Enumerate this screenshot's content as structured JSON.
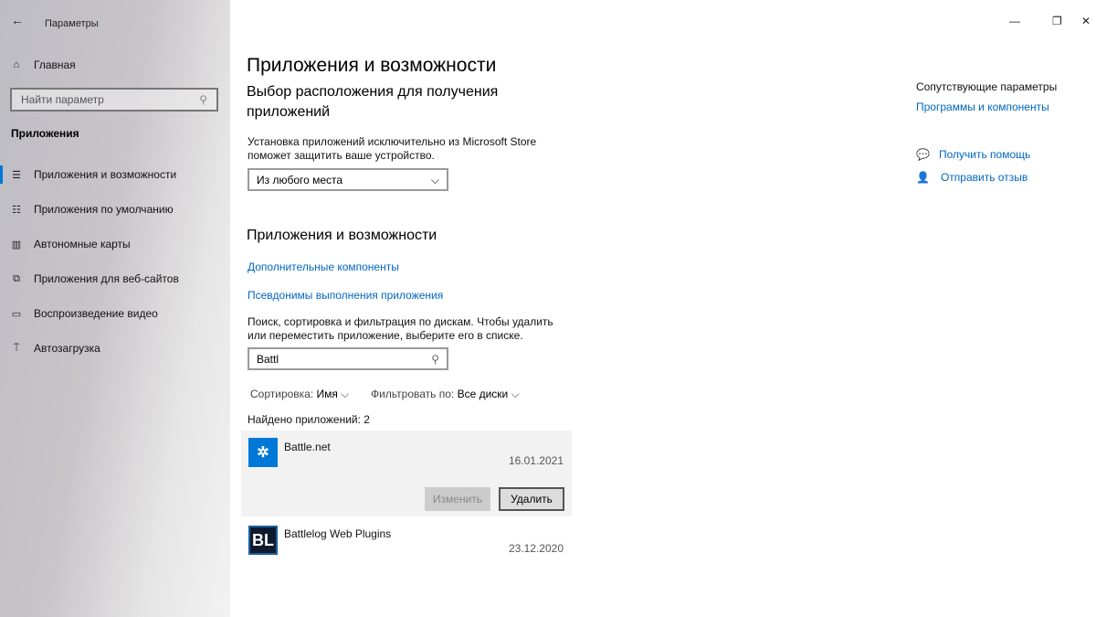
{
  "window": {
    "title": "Параметры"
  },
  "sidebar": {
    "home": "Главная",
    "search_placeholder": "Найти параметр",
    "section": "Приложения",
    "items": [
      {
        "label": "Приложения и возможности"
      },
      {
        "label": "Приложения по умолчанию"
      },
      {
        "label": "Автономные карты"
      },
      {
        "label": "Приложения для веб-сайтов"
      },
      {
        "label": "Воспроизведение видео"
      },
      {
        "label": "Автозагрузка"
      }
    ]
  },
  "main": {
    "title": "Приложения и возможности",
    "location_heading": "Выбор расположения для получения приложений",
    "location_desc": "Установка приложений исключительно из Microsoft Store поможет защитить ваше устройство.",
    "location_value": "Из любого места",
    "apps_heading": "Приложения и возможности",
    "link_components": "Дополнительные компоненты",
    "link_aliases": "Псевдонимы выполнения приложения",
    "search_desc": "Поиск, сортировка и фильтрация по дискам. Чтобы удалить или переместить приложение, выберите его в списке.",
    "search_value": "Battl",
    "sort_label": "Сортировка:",
    "sort_value": "Имя",
    "filter_label": "Фильтровать по:",
    "filter_value": "Все диски",
    "found": "Найдено приложений: 2",
    "apps": [
      {
        "name": "Battle.net",
        "date": "16.01.2021",
        "color": "#0078d7"
      },
      {
        "name": "Battlelog Web Plugins",
        "date": "23.12.2020",
        "icon_text": "BL",
        "color": "#0f1b2d"
      }
    ],
    "modify": "Изменить",
    "uninstall": "Удалить"
  },
  "related": {
    "heading": "Сопутствующие параметры",
    "link": "Программы и компоненты",
    "help": "Получить помощь",
    "feedback": "Отправить отзыв"
  }
}
